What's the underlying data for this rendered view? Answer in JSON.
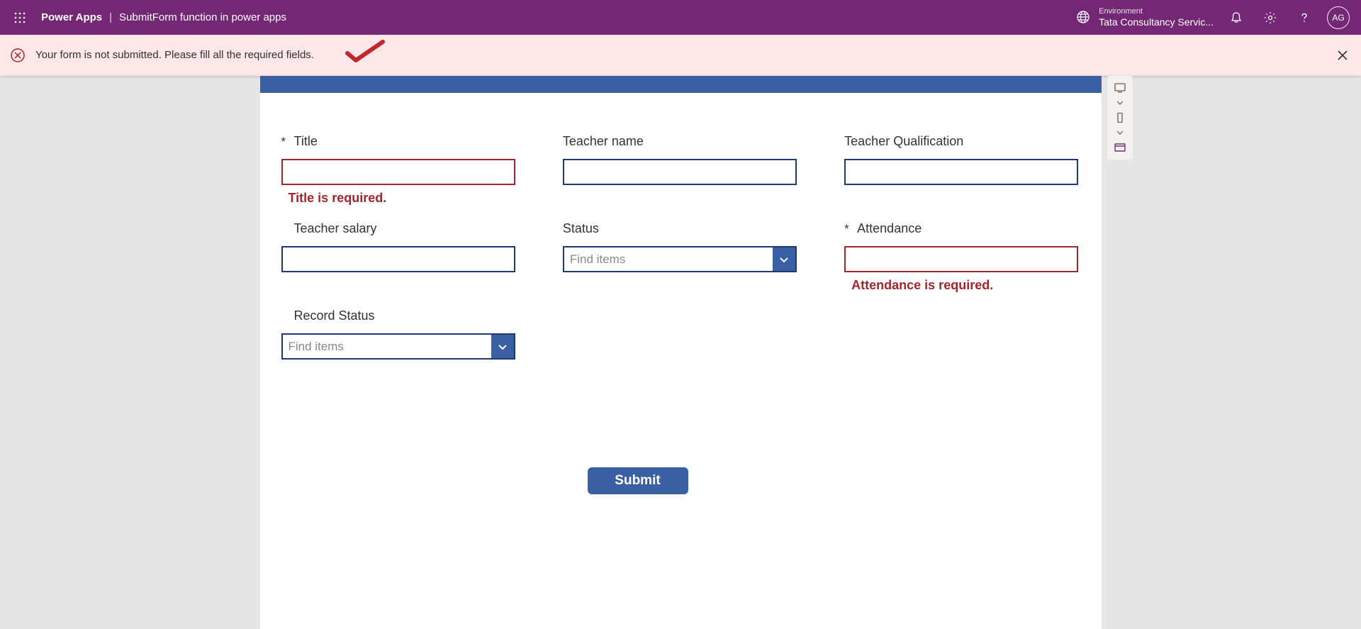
{
  "header": {
    "app": "Power Apps",
    "page": "SubmitForm function in power apps",
    "env_label": "Environment",
    "env_value": "Tata Consultancy Servic...",
    "avatar": "AG"
  },
  "notification": {
    "text": "Your form is not submitted. Please fill all the required fields."
  },
  "form": {
    "fields": {
      "title": {
        "label": "Title",
        "required": true,
        "value": "",
        "error": "Title is required."
      },
      "teacher_name": {
        "label": "Teacher name",
        "value": ""
      },
      "teacher_qual": {
        "label": "Teacher Qualification",
        "value": ""
      },
      "teacher_salary": {
        "label": "Teacher salary",
        "value": ""
      },
      "status": {
        "label": "Status",
        "placeholder": "Find items"
      },
      "attendance": {
        "label": "Attendance",
        "required": true,
        "value": "",
        "error": "Attendance is required."
      },
      "record_status": {
        "label": "Record Status",
        "placeholder": "Find items"
      }
    },
    "submit_label": "Submit"
  }
}
